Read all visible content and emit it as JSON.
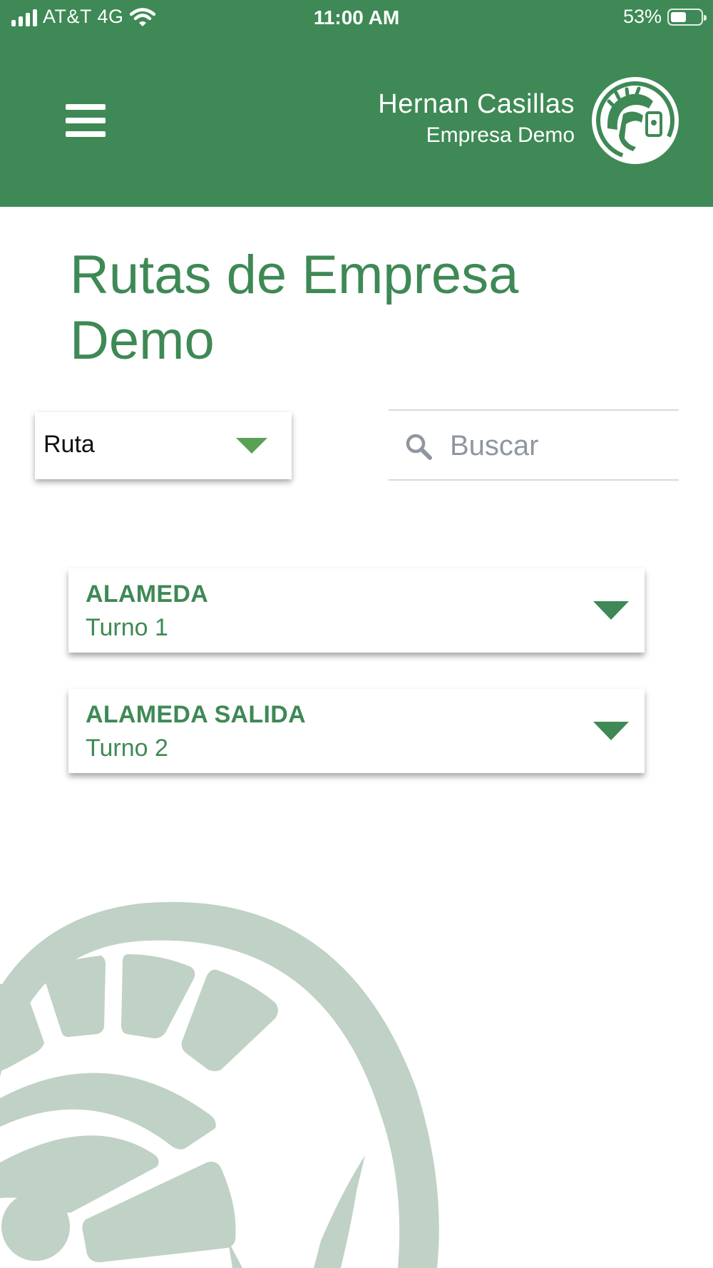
{
  "status_bar": {
    "carrier": "AT&T 4G",
    "time": "11:00 AM",
    "battery_percent": "53%",
    "battery_level": 0.53
  },
  "header": {
    "user_name": "Hernan Casillas",
    "company": "Empresa Demo",
    "menu_icon": "hamburger-menu-icon",
    "avatar_icon": "spartan-helmet-logo",
    "background_color": "#3e8955"
  },
  "page": {
    "title": "Rutas de Empresa Demo"
  },
  "filter": {
    "selected": "Ruta"
  },
  "search": {
    "placeholder": "Buscar",
    "value": ""
  },
  "routes": [
    {
      "name": "ALAMEDA",
      "shift": "Turno 1"
    },
    {
      "name": "ALAMEDA SALIDA",
      "shift": "Turno 2"
    }
  ],
  "colors": {
    "accent": "#3e8955",
    "caret_light": "#5aa055",
    "watermark": "#c0d1c5"
  }
}
